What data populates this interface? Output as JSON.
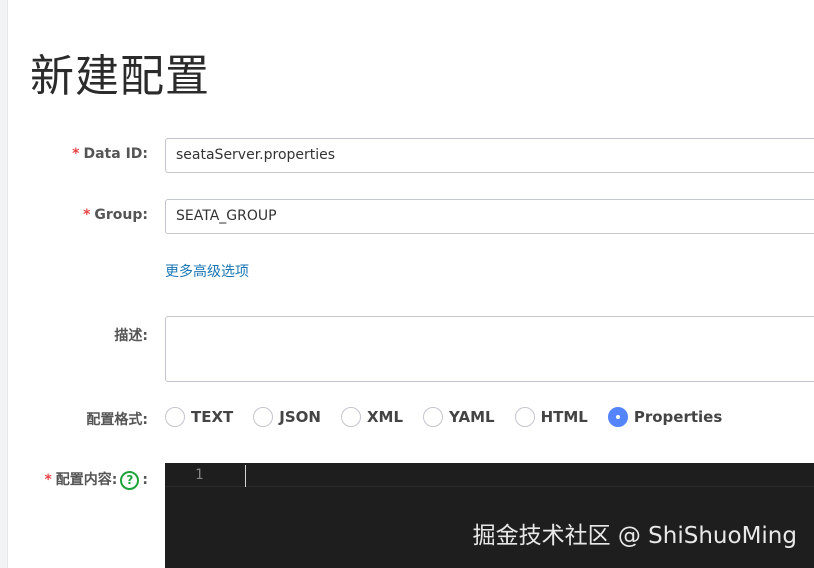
{
  "page": {
    "title": "新建配置"
  },
  "form": {
    "data_id": {
      "required_mark": "*",
      "label": "Data ID:",
      "value": "seataServer.properties"
    },
    "group": {
      "required_mark": "*",
      "label": "Group:",
      "value": "SEATA_GROUP"
    },
    "more_options_link": "更多高级选项",
    "description": {
      "label": "描述:",
      "value": ""
    },
    "format": {
      "label": "配置格式:",
      "options": [
        "TEXT",
        "JSON",
        "XML",
        "YAML",
        "HTML",
        "Properties"
      ],
      "selected": "Properties"
    },
    "content": {
      "required_mark": "*",
      "label": "配置内容:",
      "help_icon": "question-circle-icon",
      "help_glyph": "?",
      "colon": ":",
      "line_numbers": [
        "1"
      ]
    }
  },
  "watermark": "掘金技术社区 @ ShiShuoMing",
  "colors": {
    "radio_selected": "#5584ff",
    "required": "#e64545",
    "link": "#1976b3",
    "help_icon": "#1fa33b",
    "editor_bg": "#1e1e1e"
  }
}
